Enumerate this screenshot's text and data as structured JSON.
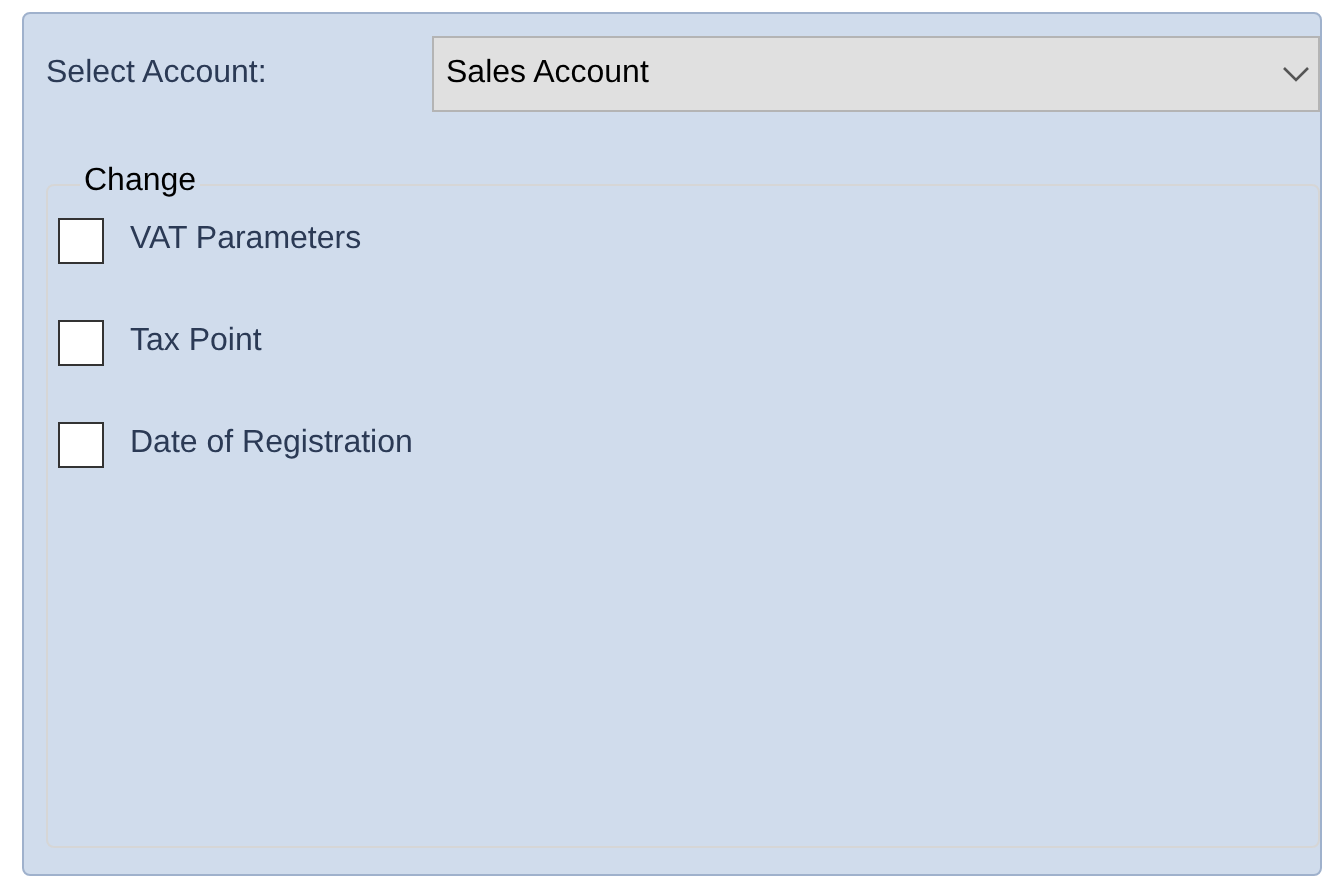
{
  "account_select": {
    "label": "Select Account:",
    "value": "Sales Account"
  },
  "change_group": {
    "title": "Change",
    "options": [
      {
        "label": "VAT Parameters",
        "checked": false
      },
      {
        "label": "Tax Point",
        "checked": false
      },
      {
        "label": "Date of Registration",
        "checked": false
      }
    ]
  }
}
